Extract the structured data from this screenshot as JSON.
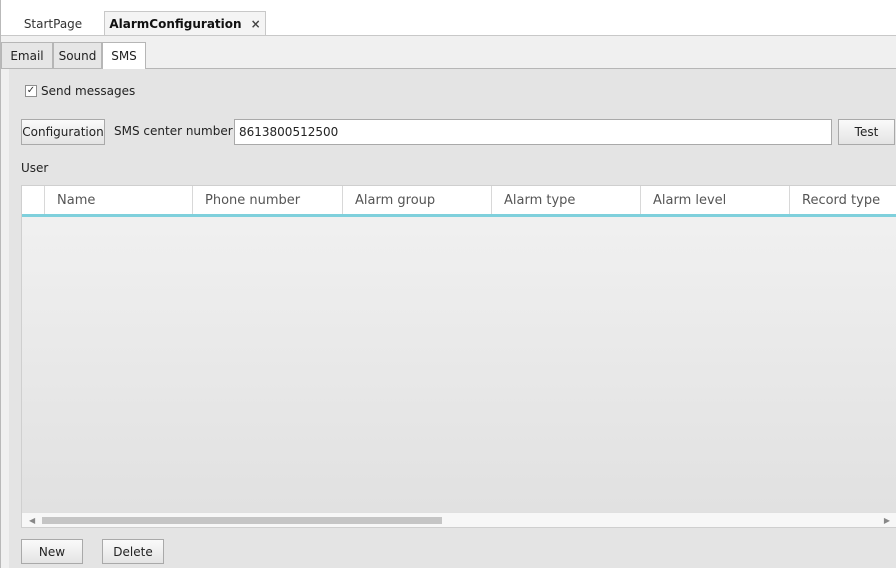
{
  "doc_tabs": {
    "start": "StartPage",
    "active": "AlarmConfiguration",
    "close_glyph": "×"
  },
  "sub_tabs": {
    "email": "Email",
    "sound": "Sound",
    "sms": "SMS"
  },
  "sms": {
    "send_messages_label": "Send messages",
    "send_messages_checked": true,
    "configuration_button": "Configuration",
    "center_number_label": "SMS center number",
    "center_number_value": "8613800512500",
    "test_button": "Test"
  },
  "users": {
    "section_label": "User",
    "columns": [
      "Name",
      "Phone number",
      "Alarm group",
      "Alarm type",
      "Alarm level",
      "Record type"
    ],
    "rows": []
  },
  "actions": {
    "new_button": "New",
    "delete_button": "Delete"
  },
  "colors": {
    "header_accent": "#7fd0dc"
  }
}
